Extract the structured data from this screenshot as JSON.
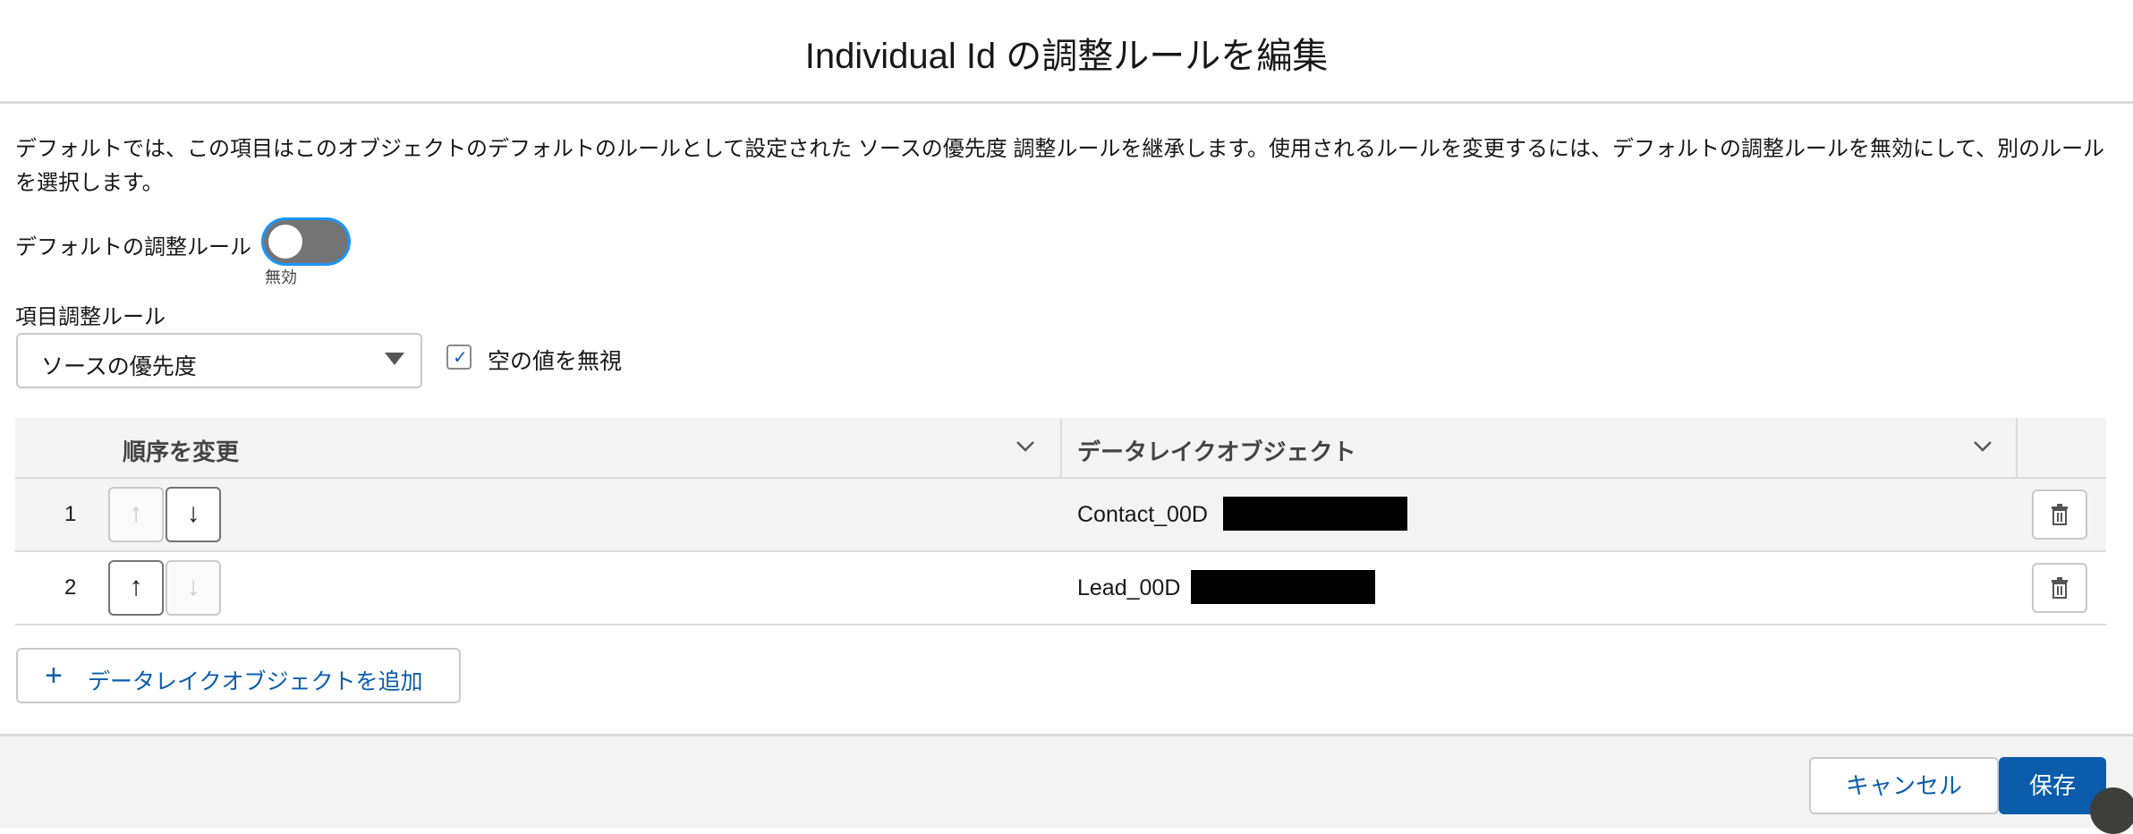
{
  "header": {
    "title": "Individual Id の調整ルールを編集"
  },
  "description": "デフォルトでは、この項目はこのオブジェクトのデフォルトのルールとして設定された ソースの優先度 調整ルールを継承します。使用されるルールを変更するには、デフォルトの調整ルールを無効にして、別のルールを選択します。",
  "default_rule": {
    "label": "デフォルトの調整ルール",
    "state_label": "無効",
    "enabled": false
  },
  "field_rule": {
    "label": "項目調整ルール",
    "selected": "ソースの優先度"
  },
  "ignore_empty": {
    "label": "空の値を無視",
    "checked": true
  },
  "table": {
    "columns": [
      "順序を変更",
      "データレイクオブジェクト"
    ],
    "rows": [
      {
        "order": "1",
        "object": "Contact_00D"
      },
      {
        "order": "2",
        "object": "Lead_00D"
      }
    ]
  },
  "add_button": {
    "label": "データレイクオブジェクトを追加"
  },
  "footer": {
    "cancel": "キャンセル",
    "save": "保存"
  },
  "colors": {
    "brand": "#0b5cab",
    "focus_ring": "#1b96ff",
    "toggle_off": "#747474"
  },
  "icons": [
    "chevron-down-icon",
    "arrow-up-icon",
    "arrow-down-icon",
    "trash-icon",
    "plus-icon",
    "check-icon",
    "caret-down-icon"
  ]
}
